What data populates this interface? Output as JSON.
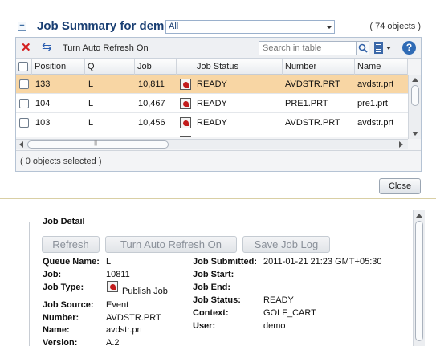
{
  "summary": {
    "title": "Job Summary for demo",
    "filter_value": "All",
    "object_count": "( 74 objects )",
    "toolbar": {
      "auto_refresh_label": "Turn Auto Refresh On",
      "search_placeholder": "Search in table"
    },
    "columns": [
      "Position",
      "Q",
      "Job",
      "",
      "Job Status",
      "Number",
      "Name"
    ],
    "rows": [
      {
        "position": "133",
        "q": "L",
        "job": "10,811",
        "status": "READY",
        "number": "AVDSTR.PRT",
        "name": "avdstr.prt",
        "selected": true
      },
      {
        "position": "104",
        "q": "L",
        "job": "10,467",
        "status": "READY",
        "number": "PRE1.PRT",
        "name": "pre1.prt",
        "selected": false
      },
      {
        "position": "103",
        "q": "L",
        "job": "10,456",
        "status": "READY",
        "number": "AVDSTR.PRT",
        "name": "avdstr.prt",
        "selected": false
      }
    ],
    "selection_text": "( 0 objects selected )",
    "close_label": "Close"
  },
  "detail": {
    "legend": "Job Detail",
    "buttons": {
      "refresh": "Refresh",
      "auto_refresh": "Turn Auto Refresh On",
      "save_log": "Save Job Log"
    },
    "left_fields": [
      {
        "label": "Queue Name:",
        "value": "L"
      },
      {
        "label": "Job:",
        "value": "10811"
      },
      {
        "label": "Job Type:",
        "value": "Publish Job"
      },
      {
        "label": "Job Source:",
        "value": "Event"
      },
      {
        "label": "Number:",
        "value": "AVDSTR.PRT"
      },
      {
        "label": "Name:",
        "value": "avdstr.prt"
      },
      {
        "label": "Version:",
        "value": "A.2"
      }
    ],
    "right_fields": [
      {
        "label": "Job Submitted:",
        "value": "2011-01-21 21:23 GMT+05:30"
      },
      {
        "label": "Job Start:",
        "value": ""
      },
      {
        "label": "Job End:",
        "value": ""
      },
      {
        "label": "Job Status:",
        "value": "READY"
      },
      {
        "label": "Context:",
        "value": "GOLF_CART"
      },
      {
        "label": "User:",
        "value": "demo"
      }
    ]
  },
  "icons": {
    "collapse": "collapse-icon",
    "delete": "delete-icon",
    "refresh": "refresh-icon",
    "search": "search-icon",
    "columns": "columns-icon",
    "help": "help-icon",
    "job_status": "publish-job-icon"
  },
  "colors": {
    "title": "#1a3f73",
    "selected_row": "#f8d6a4",
    "delete": "#d42020",
    "help": "#2f6bb5"
  }
}
